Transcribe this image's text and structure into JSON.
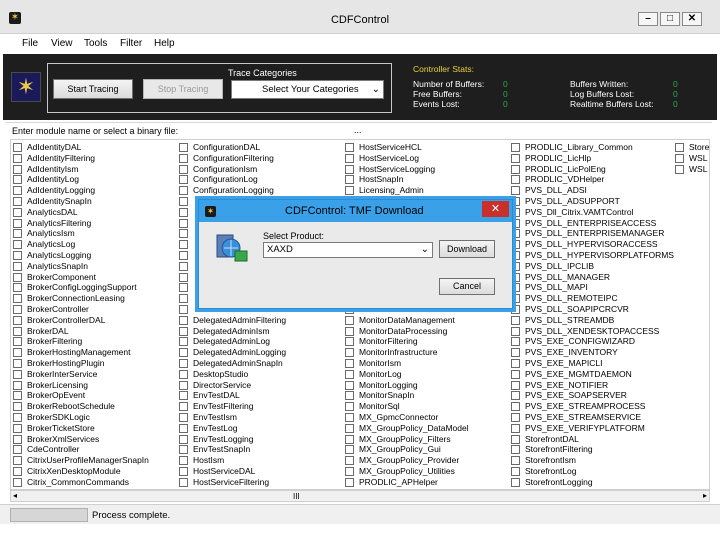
{
  "window": {
    "title": "CDFControl"
  },
  "menu": [
    "File",
    "View",
    "Tools",
    "Filter",
    "Help"
  ],
  "toolbar": {
    "start_label": "Start Tracing",
    "stop_label": "Stop Tracing",
    "trace_categories_label": "Trace Categories",
    "categories_select_value": "Select Your Categories"
  },
  "stats": {
    "title": "Controller Stats:",
    "left": [
      {
        "label": "Number of Buffers:",
        "value": "0"
      },
      {
        "label": "Free Buffers:",
        "value": "0"
      },
      {
        "label": "Events Lost:",
        "value": "0"
      }
    ],
    "right": [
      {
        "label": "Buffers Written:",
        "value": "0"
      },
      {
        "label": "Log Buffers Lost:",
        "value": "0"
      },
      {
        "label": "Realtime Buffers Lost:",
        "value": "0"
      }
    ]
  },
  "module_bar": {
    "label": "Enter module name or select a binary file:",
    "browse_label": "..."
  },
  "columns": [
    [
      "AdIdentityDAL",
      "AdIdentityFiltering",
      "AdIdentityIsm",
      "AdIdentityLog",
      "AdIdentityLogging",
      "AdIdentitySnapIn",
      "AnalyticsDAL",
      "AnalyticsFiltering",
      "AnalyticsIsm",
      "AnalyticsLog",
      "AnalyticsLogging",
      "AnalyticsSnapIn",
      "BrokerComponent",
      "BrokerConfigLoggingSupport",
      "BrokerConnectionLeasing",
      "BrokerController",
      "BrokerControllerDAL",
      "BrokerDAL",
      "BrokerFiltering",
      "BrokerHostingManagement",
      "BrokerHostingPlugin",
      "BrokerInterService",
      "BrokerLicensing",
      "BrokerOpEvent",
      "BrokerRebootSchedule",
      "BrokerSDKLogic",
      "BrokerTicketStore",
      "BrokerXmlServices",
      "CdeController",
      "CitrixUserProfileManagerSnapIn",
      "CitrixXenDesktopModule",
      "Citrix_CommonCommands"
    ],
    [
      "ConfigurationDAL",
      "ConfigurationFiltering",
      "ConfigurationIsm",
      "ConfigurationLog",
      "ConfigurationLogging",
      "",
      "",
      "",
      "",
      "",
      "",
      "",
      "",
      "",
      "",
      "",
      "DelegatedAdminFiltering",
      "DelegatedAdminIsm",
      "DelegatedAdminLog",
      "DelegatedAdminLogging",
      "DelegatedAdminSnapIn",
      "DesktopStudio",
      "DirectorService",
      "EnvTestDAL",
      "EnvTestFiltering",
      "EnvTestIsm",
      "EnvTestLog",
      "EnvTestLogging",
      "EnvTestSnapIn",
      "HostIsm",
      "HostServiceDAL",
      "HostServiceFiltering"
    ],
    [
      "HostServiceHCL",
      "HostServiceLog",
      "HostServiceLogging",
      "HostSnapIn",
      "Licensing_Admin",
      "",
      "",
      "",
      "",
      "",
      "",
      "",
      "",
      "",
      "",
      "",
      "MonitorDataManagement",
      "MonitorDataProcessing",
      "MonitorFiltering",
      "MonitorInfrastructure",
      "MonitorIsm",
      "MonitorLog",
      "MonitorLogging",
      "MonitorSnapIn",
      "MonitorSql",
      "MX_GpmcConnector",
      "MX_GroupPolicy_DataModel",
      "MX_GroupPolicy_Filters",
      "MX_GroupPolicy_Gui",
      "MX_GroupPolicy_Provider",
      "MX_GroupPolicy_Utilities",
      "PRODLIC_APHelper"
    ],
    [
      "PRODLIC_Library_Common",
      "PRODLIC_LicHlp",
      "PRODLIC_LicPolEng",
      "PRODLIC_VDHelper",
      "PVS_DLL_ADSI",
      "PVS_DLL_ADSUPPORT",
      "PVS_Dll_Citrix.VAMTControl",
      "PVS_DLL_ENTERPRISEACCESS",
      "PVS_DLL_ENTERPRISEMANAGER",
      "PVS_DLL_HYPERVISORACCESS",
      "PVS_DLL_HYPERVISORPLATFORMS",
      "PVS_DLL_IPCLIB",
      "PVS_DLL_MANAGER",
      "PVS_DLL_MAPI",
      "PVS_DLL_REMOTEIPC",
      "PVS_DLL_SOAPIPCRCVR",
      "PVS_DLL_STREAMDB",
      "PVS_DLL_XENDESKTOPACCESS",
      "PVS_EXE_CONFIGWIZARD",
      "PVS_EXE_INVENTORY",
      "PVS_EXE_MAPICLI",
      "PVS_EXE_MGMTDAEMON",
      "PVS_EXE_NOTIFIER",
      "PVS_EXE_SOAPSERVER",
      "PVS_EXE_STREAMPROCESS",
      "PVS_EXE_STREAMSERVICE",
      "PVS_EXE_VERIFYPLATFORM",
      "StorefrontDAL",
      "StorefrontFiltering",
      "StorefrontIsm",
      "StorefrontLog",
      "StorefrontLogging"
    ],
    [
      "Storef",
      "WSL",
      "WSL"
    ]
  ],
  "dialog": {
    "title": "CDFControl: TMF Download",
    "close": "✕",
    "select_product_label": "Select Product:",
    "product_value": "XAXD",
    "download_label": "Download",
    "cancel_label": "Cancel"
  },
  "hscroll": {
    "left": "◂",
    "right": "▸",
    "thumb": "III"
  },
  "status": {
    "text": "Process complete."
  }
}
